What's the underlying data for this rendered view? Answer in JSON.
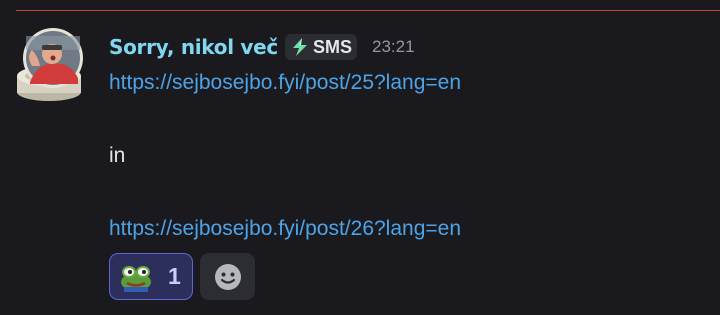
{
  "message": {
    "author": "Sorry, nikol več",
    "tag_label": "SMS",
    "tag_icon": "lightning-bolt-icon",
    "timestamp": "23:21",
    "lines": [
      "https://sejbosejbo.fyi/post/25?lang=en",
      "in",
      "https://sejbosejbo.fyi/post/26?lang=en"
    ]
  },
  "reactions": [
    {
      "emoji": "frog-emoji-icon",
      "count": "1",
      "reacted": true
    }
  ],
  "add_reaction": {
    "icon": "smiley-face-icon"
  },
  "colors": {
    "background": "#1a1a1e",
    "divider": "#c0463f",
    "username": "#7fd7f0",
    "link": "#4da3e8",
    "timestamp": "#94979d",
    "reaction_active_border": "#5b66d8"
  }
}
